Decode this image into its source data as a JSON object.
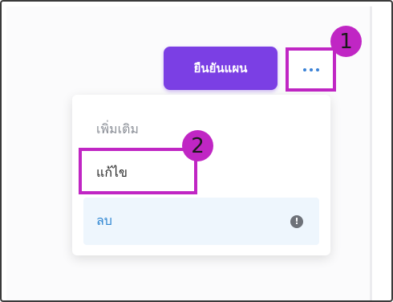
{
  "toolbar": {
    "confirm_label": "ยืนยันแผน",
    "more_icon": "more-horizontal-icon"
  },
  "menu": {
    "items": [
      {
        "label": "เพิ่มเติม",
        "state": "disabled"
      },
      {
        "label": "แก้ไข",
        "state": "normal"
      },
      {
        "label": "ลบ",
        "state": "hovered",
        "icon": "info-icon"
      }
    ]
  },
  "annotations": {
    "step1": "1",
    "step2": "2"
  },
  "colors": {
    "primary": "#7b3fe4",
    "highlight": "#c026c4",
    "link_blue": "#2f86d2",
    "hover_bg": "#eef6fd"
  }
}
